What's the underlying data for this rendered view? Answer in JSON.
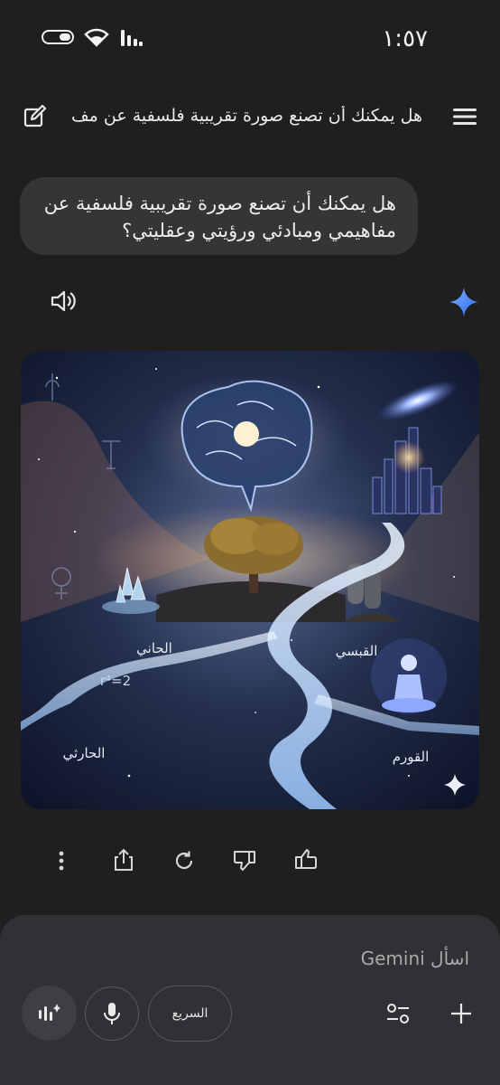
{
  "status_bar": {
    "time": "١:٥٧"
  },
  "header": {
    "title": "هل يمكنك أن تصنع صورة تقريبية فلسفية عن مف..."
  },
  "conversation": {
    "user_message": "هل يمكنك أن تصنع صورة تقريبية فلسفية عن مفاهيمي ومبادئي ورؤيتي وعقليتي؟"
  },
  "image_labels": {
    "top_left": "الحاني",
    "right": "القبسي",
    "bottom_left": "الحارثي",
    "bottom_right": "القورم",
    "equation": "r⁴=2"
  },
  "input": {
    "placeholder": "اسأل Gemini",
    "fast_label": "السريع"
  },
  "colors": {
    "background": "#1f1f1f",
    "bubble": "#333537",
    "panel": "#303134",
    "gemini_blue": "#4a8cff"
  }
}
